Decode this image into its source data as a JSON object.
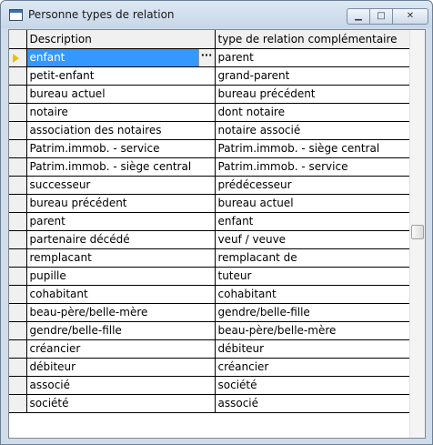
{
  "window": {
    "title": "Personne types de relation",
    "minimize_glyph": "▁",
    "maximize_glyph": "□",
    "close_glyph": "✕",
    "icon": "window-icon"
  },
  "grid": {
    "columns": [
      "Description",
      "type de relation complémentaire"
    ],
    "current_row_indicator": "arrow-right-icon",
    "ellipsis_label": "···",
    "rows": [
      [
        "enfant",
        "parent"
      ],
      [
        "petit-enfant",
        "grand-parent"
      ],
      [
        "bureau actuel",
        "bureau précédent"
      ],
      [
        "notaire",
        "dont notaire"
      ],
      [
        "association des notaires",
        "notaire associé"
      ],
      [
        "Patrim.immob. - service",
        "Patrim.immob. - siège central"
      ],
      [
        "Patrim.immob. - siège central",
        "Patrim.immob. - service"
      ],
      [
        "successeur",
        "prédécesseur"
      ],
      [
        "bureau précédent",
        "bureau actuel"
      ],
      [
        "parent",
        "enfant"
      ],
      [
        "partenaire décédé",
        "veuf / veuve"
      ],
      [
        "remplacant",
        "remplacant de"
      ],
      [
        "pupille",
        "tuteur"
      ],
      [
        "cohabitant",
        "cohabitant"
      ],
      [
        "beau-père/belle-mère",
        "gendre/belle-fille"
      ],
      [
        "gendre/belle-fille",
        "beau-père/belle-mère"
      ],
      [
        "créancier",
        "débiteur"
      ],
      [
        "débiteur",
        "créancier"
      ],
      [
        "associé",
        "société"
      ],
      [
        "société",
        "associé"
      ]
    ]
  },
  "colors": {
    "selection": "#3399ff",
    "indicator": "#e7c300"
  }
}
